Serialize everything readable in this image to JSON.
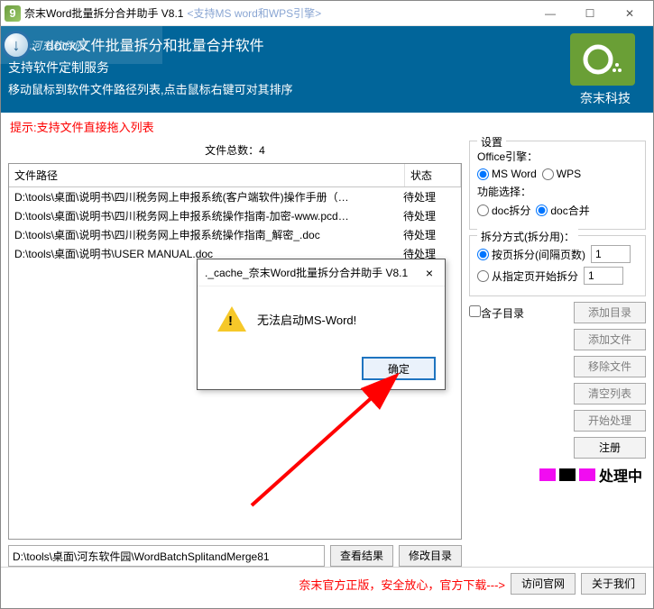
{
  "titlebar": {
    "title": "奈末Word批量拆分合并助手 V8.1",
    "sub": "<支持MS word和WPS引擎>",
    "min": "—",
    "max": "☐",
    "close": "✕"
  },
  "banner": {
    "line1": "doc、docx文件批量拆分和批量合并软件",
    "line2": "支持软件定制服务",
    "line3": "移动鼠标到软件文件路径列表,点击鼠标右键可对其排序",
    "brand": "奈末科技"
  },
  "watermark": "河东软件园",
  "hint": "提示:支持文件直接拖入列表",
  "stats_label": "文件总数：",
  "stats_value": "4",
  "table": {
    "col_path": "文件路径",
    "col_status": "状态",
    "rows": [
      {
        "path": "D:\\tools\\桌面\\说明书\\四川税务网上申报系统(客户端软件)操作手册（…",
        "status": "待处理"
      },
      {
        "path": "D:\\tools\\桌面\\说明书\\四川税务网上申报系统操作指南-加密-www.pcd…",
        "status": "待处理"
      },
      {
        "path": "D:\\tools\\桌面\\说明书\\四川税务网上申报系统操作指南_解密_.doc",
        "status": "待处理"
      },
      {
        "path": "D:\\tools\\桌面\\说明书\\USER MANUAL.doc",
        "status": "待处理"
      }
    ]
  },
  "bottom": {
    "path": "D:\\tools\\桌面\\河东软件园\\WordBatchSplitandMerge81",
    "view": "查看结果",
    "modify": "修改目录"
  },
  "settings": {
    "group": "设置",
    "engine_label": "Office引擎：",
    "engine_msword": "MS Word",
    "engine_wps": "WPS",
    "func_label": "功能选择：",
    "func_split": "doc拆分",
    "func_merge": "doc合并",
    "split_group": "拆分方式(拆分用)：",
    "split_page": "按页拆分(间隔页数)",
    "split_from": "从指定页开始拆分",
    "split_page_val": "1",
    "split_from_val": "1",
    "include_sub": "含子目录"
  },
  "actions": {
    "add_dir": "添加目录",
    "add_file": "添加文件",
    "remove": "移除文件",
    "clear": "清空列表",
    "start": "开始处理",
    "register": "注册"
  },
  "proc_status": "处理中",
  "footer": {
    "text": "奈末官方正版，安全放心，官方下载--->",
    "visit": "访问官网",
    "about": "关于我们"
  },
  "dialog": {
    "title": "._cache_奈末Word批量拆分合并助手 V8.1",
    "msg": "无法启动MS-Word!",
    "ok": "确定",
    "close": "×"
  }
}
